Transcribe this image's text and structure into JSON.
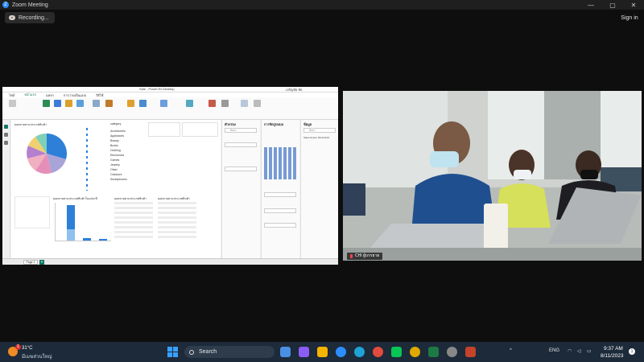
{
  "window": {
    "title": "Zoom Meeting",
    "sign_in_label": "Sign in",
    "recording_label": "Recording...",
    "controls": {
      "minimize": "—",
      "maximize": "▢",
      "close": "✕"
    }
  },
  "shared_screen": {
    "app_title": "Sale - Power BI Desktop",
    "user_name": "เจริญชัย ชัย",
    "menu_tabs": [
      "ไฟล์",
      "หน้าแรก",
      "แทรก",
      "การวาดเป็นแบบ",
      "วิธีใช้"
    ],
    "visuals": {
      "pie_title": "ยอดขายตามประเภทสินค้า",
      "bar_title": "ยอดขายตามประเภทสินค้าในแต่ละปี",
      "table1_title": "ยอดขายตามประเภทสินค้า",
      "table2_title": "ยอดขายตามประเภทสินค้า",
      "slicer_title": "category",
      "slicer_items": [
        "Accessories",
        "Appliances",
        "Beauty",
        "Books",
        "Clothing",
        "Electronics",
        "Games",
        "Jewelry",
        "Other",
        "Outdoors",
        "Smartphones"
      ]
    },
    "panes": {
      "filters_title": "ตัวกรอง",
      "filters_search": "ค้นหา",
      "viz_title": "การจัดรูปแบบ",
      "data_title": "ข้อมูล",
      "data_search": "ค้นหา",
      "data_item": "Sales Export 2019-2021"
    },
    "page_tab": "Page 1",
    "page_add": "+"
  },
  "participant": {
    "name": "CHI ผู้บรรยาย"
  },
  "taskbar": {
    "weather_temp": "31°C",
    "weather_desc": "มีเมฆส่วนใหญ่",
    "weather_badge": "1",
    "search_label": "Search",
    "language": "ENG",
    "time": "9:37 AM",
    "date": "8/11/2023",
    "notification_count": "1",
    "tray_chevron": "^"
  }
}
